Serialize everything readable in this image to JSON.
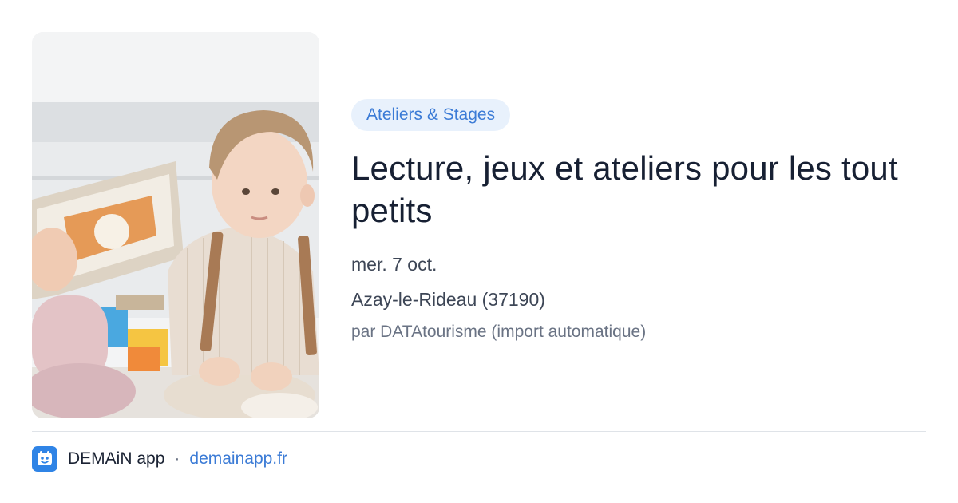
{
  "image": {
    "icon": "photo-child-reading",
    "colors": {
      "wall": "#f4f5f6",
      "shirt": "#e8ddd2",
      "suspenders": "#a87a55",
      "hair": "#b89673"
    }
  },
  "event": {
    "category": "Ateliers & Stages",
    "title": "Lecture, jeux et ateliers pour les tout petits",
    "date": "mer. 7 oct.",
    "location": "Azay-le-Rideau (37190)",
    "source": "par DATAtourisme (import automatique)"
  },
  "footer": {
    "app_icon": "demain-app-logo-icon",
    "app_name": "DEMAiN app",
    "separator": "·",
    "site": "demainapp.fr"
  },
  "colors": {
    "accent": "#3b7bd6",
    "badge_bg": "#e8f1fc",
    "text": "#172033",
    "muted": "#6a7384",
    "logo_bg": "#2f84e6"
  }
}
